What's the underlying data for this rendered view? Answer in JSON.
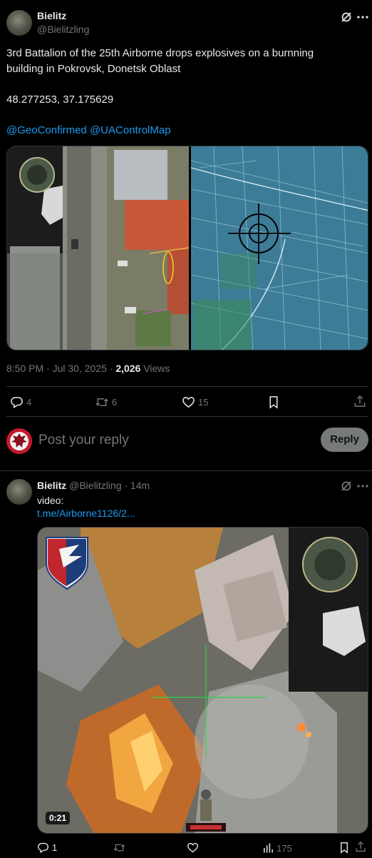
{
  "tweet": {
    "author_name": "Bielitz",
    "author_handle": "@Bielitzling",
    "text_line1": "3rd Battalion of the 25th Airborne drops explosives on a burnning",
    "text_line2": "building in Pokrovsk, Donetsk Oblast",
    "coordinates": "48.277253, 37.175629",
    "mention1": "@GeoConfirmed",
    "mention2": "@UAControlMap",
    "timestamp": "8:50 PM · Jul 30, 2025 · ",
    "views_count": "2,026",
    "views_label": " Views",
    "replies": "4",
    "reposts": "6",
    "likes": "15"
  },
  "composer": {
    "placeholder": "Post your reply",
    "reply_button": "Reply"
  },
  "reply_tweet": {
    "author_name": "Bielitz",
    "author_handle": "@Bielitzling",
    "time": " · 14m",
    "text": "video:",
    "link": "t.me/Airborne1126/2...",
    "video_duration": "0:21",
    "replies": "1",
    "views": "175"
  },
  "colors": {
    "link": "#1d9bf0",
    "muted": "#71767b",
    "divider": "#2f3336"
  }
}
